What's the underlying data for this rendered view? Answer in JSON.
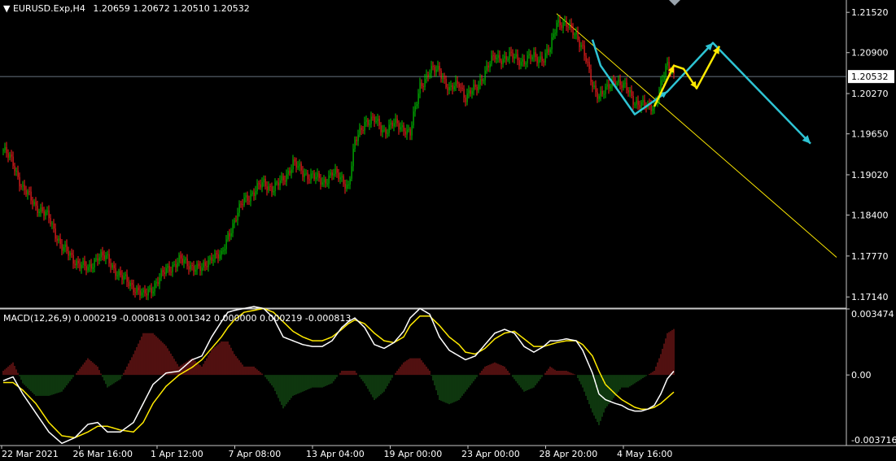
{
  "header": {
    "symbol": "EURUSD.Exp,H4",
    "ohlc": "1.20659 1.20672 1.20510 1.20532",
    "arrow": "▼"
  },
  "macd_header": "MACD(12,26,9) 0.000219 -0.000813 0.001342 0.000000 0.000219 -0.000813",
  "colors": {
    "background": "#000000",
    "bull": "#00c800",
    "bear": "#ff2020",
    "pattern_cyan": "#2ec4d4",
    "pattern_yellow": "#ffea00",
    "trendline": "#ffea00",
    "price_line": "#8a9aa8",
    "macd_main": "#ffffff",
    "macd_signal": "#ffea00",
    "hist_pos": "#b42323",
    "hist_neg": "#1f7a1f"
  },
  "chart_data": [
    {
      "type": "candlestick",
      "symbol": "EURUSD.Exp",
      "timeframe": "H4",
      "y_ticks": [
        "1.21520",
        "1.20900",
        "1.20270",
        "1.19650",
        "1.19020",
        "1.18400",
        "1.17770",
        "1.17140"
      ],
      "ylim": [
        1.1698,
        1.2171
      ],
      "current_price": "1.20532",
      "x_ticks": [
        "22 Mar 2021",
        "26 Mar 16:00",
        "1 Apr 12:00",
        "7 Apr 08:00",
        "13 Apr 04:00",
        "19 Apr 00:00",
        "23 Apr 00:00",
        "28 Apr 20:00",
        "4 May 16:00"
      ],
      "close_path": [
        [
          0,
          1.194
        ],
        [
          6,
          1.192
        ],
        [
          12,
          1.188
        ],
        [
          20,
          1.1855
        ],
        [
          28,
          1.1835
        ],
        [
          36,
          1.179
        ],
        [
          44,
          1.177
        ],
        [
          52,
          1.1755
        ],
        [
          58,
          1.1778
        ],
        [
          64,
          1.1772
        ],
        [
          72,
          1.1745
        ],
        [
          80,
          1.173
        ],
        [
          86,
          1.1715
        ],
        [
          92,
          1.173
        ],
        [
          100,
          1.1755
        ],
        [
          108,
          1.177
        ],
        [
          116,
          1.1762
        ],
        [
          122,
          1.1755
        ],
        [
          128,
          1.1778
        ],
        [
          134,
          1.1775
        ],
        [
          138,
          1.181
        ],
        [
          142,
          1.183
        ],
        [
          148,
          1.1865
        ],
        [
          154,
          1.1875
        ],
        [
          160,
          1.189
        ],
        [
          166,
          1.188
        ],
        [
          172,
          1.1895
        ],
        [
          178,
          1.192
        ],
        [
          184,
          1.1905
        ],
        [
          190,
          1.19
        ],
        [
          196,
          1.189
        ],
        [
          202,
          1.1905
        ],
        [
          208,
          1.1895
        ],
        [
          212,
          1.1885
        ],
        [
          216,
          1.195
        ],
        [
          222,
          1.1985
        ],
        [
          228,
          1.1985
        ],
        [
          234,
          1.197
        ],
        [
          240,
          1.198
        ],
        [
          246,
          1.1975
        ],
        [
          250,
          1.1965
        ],
        [
          256,
          1.204
        ],
        [
          262,
          1.206
        ],
        [
          268,
          1.2065
        ],
        [
          274,
          1.203
        ],
        [
          280,
          1.2045
        ],
        [
          284,
          1.202
        ],
        [
          290,
          1.2035
        ],
        [
          296,
          1.206
        ],
        [
          302,
          1.2085
        ],
        [
          308,
          1.208
        ],
        [
          314,
          1.2085
        ],
        [
          320,
          1.2075
        ],
        [
          326,
          1.2085
        ],
        [
          332,
          1.208
        ],
        [
          336,
          1.2095
        ],
        [
          340,
          1.214
        ],
        [
          346,
          1.213
        ],
        [
          352,
          1.212
        ],
        [
          356,
          1.2095
        ],
        [
          362,
          1.204
        ],
        [
          366,
          1.2025
        ],
        [
          370,
          1.203
        ],
        [
          376,
          1.205
        ],
        [
          380,
          1.204
        ],
        [
          384,
          1.203
        ],
        [
          388,
          1.2015
        ],
        [
          392,
          1.201
        ],
        [
          396,
          1.2005
        ],
        [
          400,
          1.201
        ],
        [
          404,
          1.204
        ],
        [
          408,
          1.207
        ],
        [
          412,
          1.206
        ]
      ],
      "cyan_zigzag": [
        [
          362,
          1.211
        ],
        [
          367,
          1.207
        ],
        [
          388,
          1.1995
        ],
        [
          408,
          1.203
        ],
        [
          436,
          1.2105
        ],
        [
          496,
          1.195
        ]
      ],
      "yellow_zigzag": [
        [
          400,
          1.2007
        ],
        [
          412,
          1.207
        ],
        [
          418,
          1.2065
        ],
        [
          426,
          1.2035
        ],
        [
          440,
          1.21
        ]
      ],
      "trendline": [
        [
          340,
          1.215
        ],
        [
          512,
          1.1775
        ]
      ]
    },
    {
      "type": "macd",
      "params": "12,26,9",
      "values": [
        "0.000219",
        "-0.000813",
        "0.001342",
        "0.000000",
        "0.000219",
        "-0.000813"
      ],
      "y_ticks": [
        "0.003474",
        "0.00",
        "-0.003716"
      ],
      "ylim": [
        -0.003716,
        0.003474
      ],
      "main": [
        [
          0,
          -0.0003
        ],
        [
          6,
          -0.0001
        ],
        [
          12,
          -0.001
        ],
        [
          20,
          -0.002
        ],
        [
          28,
          -0.003
        ],
        [
          36,
          -0.0036
        ],
        [
          44,
          -0.0033
        ],
        [
          52,
          -0.0026
        ],
        [
          58,
          -0.0025
        ],
        [
          64,
          -0.003
        ],
        [
          72,
          -0.003
        ],
        [
          80,
          -0.0025
        ],
        [
          86,
          -0.0015
        ],
        [
          92,
          -0.0005
        ],
        [
          100,
          0.0001
        ],
        [
          108,
          0.0002
        ],
        [
          116,
          0.0008
        ],
        [
          122,
          0.001
        ],
        [
          128,
          0.002
        ],
        [
          134,
          0.0028
        ],
        [
          138,
          0.0033
        ],
        [
          142,
          0.0034
        ],
        [
          148,
          0.0035
        ],
        [
          154,
          0.0036
        ],
        [
          160,
          0.0035
        ],
        [
          166,
          0.003
        ],
        [
          172,
          0.002
        ],
        [
          178,
          0.0018
        ],
        [
          184,
          0.0016
        ],
        [
          190,
          0.0015
        ],
        [
          196,
          0.0015
        ],
        [
          202,
          0.0018
        ],
        [
          208,
          0.0025
        ],
        [
          212,
          0.0028
        ],
        [
          216,
          0.003
        ],
        [
          222,
          0.0025
        ],
        [
          228,
          0.0016
        ],
        [
          234,
          0.0014
        ],
        [
          240,
          0.0017
        ],
        [
          246,
          0.0023
        ],
        [
          250,
          0.003
        ],
        [
          256,
          0.0035
        ],
        [
          262,
          0.0032
        ],
        [
          268,
          0.002
        ],
        [
          274,
          0.0013
        ],
        [
          280,
          0.001
        ],
        [
          284,
          0.0008
        ],
        [
          290,
          0.001
        ],
        [
          296,
          0.0016
        ],
        [
          302,
          0.0022
        ],
        [
          308,
          0.0024
        ],
        [
          314,
          0.0022
        ],
        [
          320,
          0.0015
        ],
        [
          326,
          0.0012
        ],
        [
          332,
          0.0015
        ],
        [
          336,
          0.0018
        ],
        [
          340,
          0.0018
        ],
        [
          346,
          0.0019
        ],
        [
          352,
          0.0018
        ],
        [
          356,
          0.0013
        ],
        [
          362,
          0.0001
        ],
        [
          366,
          -0.001
        ],
        [
          370,
          -0.0013
        ],
        [
          376,
          -0.0015
        ],
        [
          380,
          -0.0016
        ],
        [
          384,
          -0.0018
        ],
        [
          388,
          -0.0019
        ],
        [
          392,
          -0.0019
        ],
        [
          396,
          -0.0018
        ],
        [
          400,
          -0.0016
        ],
        [
          404,
          -0.001
        ],
        [
          408,
          -0.0002
        ],
        [
          412,
          0.0002
        ]
      ],
      "signal": [
        [
          0,
          -0.0004
        ],
        [
          6,
          -0.0004
        ],
        [
          12,
          -0.0008
        ],
        [
          20,
          -0.0015
        ],
        [
          28,
          -0.0025
        ],
        [
          36,
          -0.0032
        ],
        [
          44,
          -0.0033
        ],
        [
          52,
          -0.003
        ],
        [
          58,
          -0.0027
        ],
        [
          64,
          -0.0027
        ],
        [
          72,
          -0.0029
        ],
        [
          80,
          -0.003
        ],
        [
          86,
          -0.0025
        ],
        [
          92,
          -0.0015
        ],
        [
          100,
          -0.0006
        ],
        [
          108,
          0.0
        ],
        [
          116,
          0.0004
        ],
        [
          122,
          0.0008
        ],
        [
          128,
          0.0014
        ],
        [
          134,
          0.002
        ],
        [
          138,
          0.0025
        ],
        [
          142,
          0.0029
        ],
        [
          148,
          0.0033
        ],
        [
          154,
          0.0034
        ],
        [
          160,
          0.0035
        ],
        [
          166,
          0.0033
        ],
        [
          172,
          0.0028
        ],
        [
          178,
          0.0023
        ],
        [
          184,
          0.002
        ],
        [
          190,
          0.0018
        ],
        [
          196,
          0.0018
        ],
        [
          202,
          0.002
        ],
        [
          208,
          0.0024
        ],
        [
          212,
          0.0027
        ],
        [
          216,
          0.0029
        ],
        [
          222,
          0.0027
        ],
        [
          228,
          0.0022
        ],
        [
          234,
          0.0018
        ],
        [
          240,
          0.0017
        ],
        [
          246,
          0.002
        ],
        [
          250,
          0.0026
        ],
        [
          256,
          0.0031
        ],
        [
          262,
          0.0031
        ],
        [
          268,
          0.0026
        ],
        [
          274,
          0.002
        ],
        [
          280,
          0.0016
        ],
        [
          284,
          0.0012
        ],
        [
          290,
          0.0011
        ],
        [
          296,
          0.0014
        ],
        [
          302,
          0.0019
        ],
        [
          308,
          0.0022
        ],
        [
          314,
          0.0023
        ],
        [
          320,
          0.0019
        ],
        [
          326,
          0.0015
        ],
        [
          332,
          0.0015
        ],
        [
          336,
          0.0016
        ],
        [
          340,
          0.0017
        ],
        [
          346,
          0.0018
        ],
        [
          352,
          0.0018
        ],
        [
          356,
          0.0016
        ],
        [
          362,
          0.001
        ],
        [
          366,
          0.0002
        ],
        [
          370,
          -0.0005
        ],
        [
          376,
          -0.001
        ],
        [
          380,
          -0.0013
        ],
        [
          384,
          -0.0015
        ],
        [
          388,
          -0.0017
        ],
        [
          392,
          -0.0018
        ],
        [
          396,
          -0.0018
        ],
        [
          400,
          -0.0017
        ],
        [
          404,
          -0.0015
        ],
        [
          408,
          -0.0012
        ],
        [
          412,
          -0.0009
        ]
      ]
    }
  ]
}
